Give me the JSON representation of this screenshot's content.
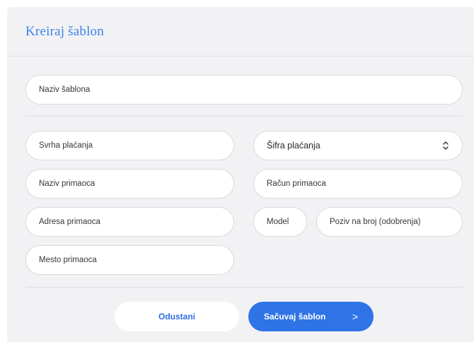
{
  "header": {
    "title": "Kreiraj šablon"
  },
  "form": {
    "template_name": {
      "placeholder": "Naziv šablona"
    },
    "payment_purpose": {
      "placeholder": "Svrha plaćanja"
    },
    "payment_code": {
      "label": "Šifra plaćanja",
      "icon": "chevron-up-down-icon"
    },
    "recipient_name": {
      "placeholder": "Naziv primaoca"
    },
    "recipient_account": {
      "placeholder": "Račun primaoca"
    },
    "recipient_address": {
      "placeholder": "Adresa primaoca"
    },
    "model": {
      "placeholder": "Model"
    },
    "reference_number": {
      "placeholder": "Poziv na broj (odobrenja)"
    },
    "recipient_city": {
      "placeholder": "Mesto primaoca"
    }
  },
  "actions": {
    "cancel_label": "Odustani",
    "save_label": "Sačuvaj šablon",
    "save_arrow": ">"
  },
  "colors": {
    "accent": "#2f74e6",
    "title": "#3b82e8",
    "panel_bg": "#f2f2f4"
  }
}
